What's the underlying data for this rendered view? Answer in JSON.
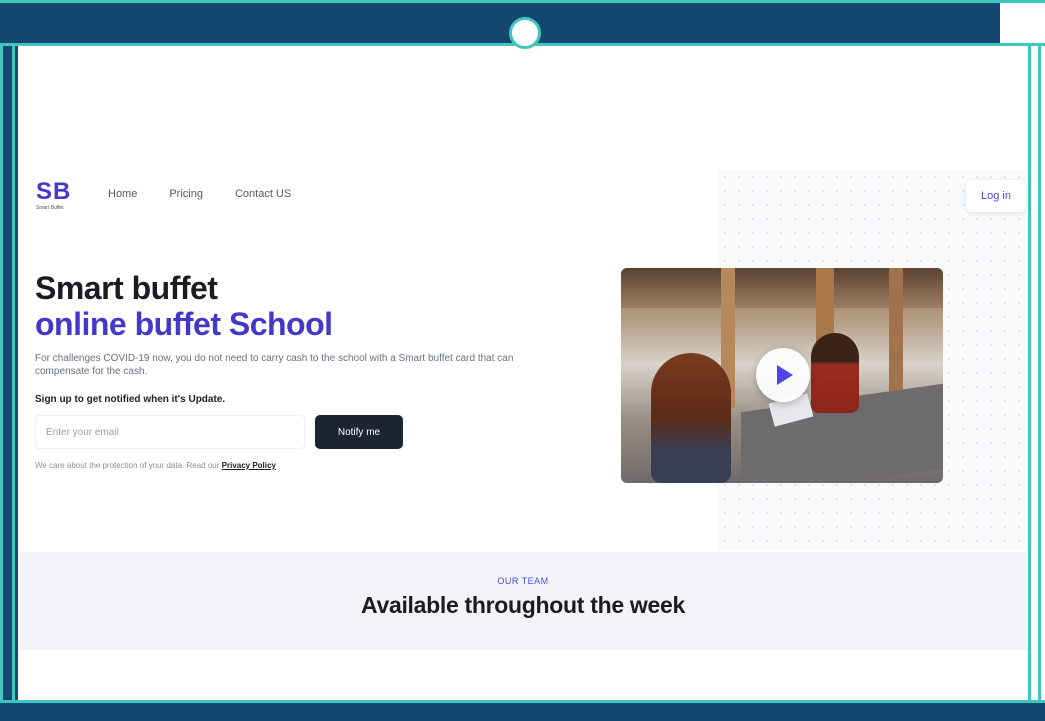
{
  "nav": {
    "logo_mark": "SB",
    "logo_sub": "Smart Buffet",
    "links": [
      {
        "label": "Home"
      },
      {
        "label": "Pricing"
      },
      {
        "label": "Contact US"
      }
    ],
    "login_label": "Log in"
  },
  "hero": {
    "title_line1": "Smart buffet",
    "title_line2": "online buffet School",
    "description": "For challenges COVID-19 now, you do not need to carry cash to the school with a Smart buffet card that can compensate for the cash.",
    "signup_label": "Sign up to get notified when it's Update.",
    "email_placeholder": "Enter your email",
    "notify_label": "Notify me",
    "privacy_text": "We care about the protection of your data. Read our ",
    "privacy_link": "Privacy Policy"
  },
  "video": {
    "play_icon": "play-icon"
  },
  "team": {
    "eyebrow": "OUR TEAM",
    "title": "Available throughout the week"
  },
  "colors": {
    "accent": "#4338ca",
    "frame": "#15466f",
    "frame_outline": "#3fc7bd",
    "button_dark": "#1e2432"
  }
}
